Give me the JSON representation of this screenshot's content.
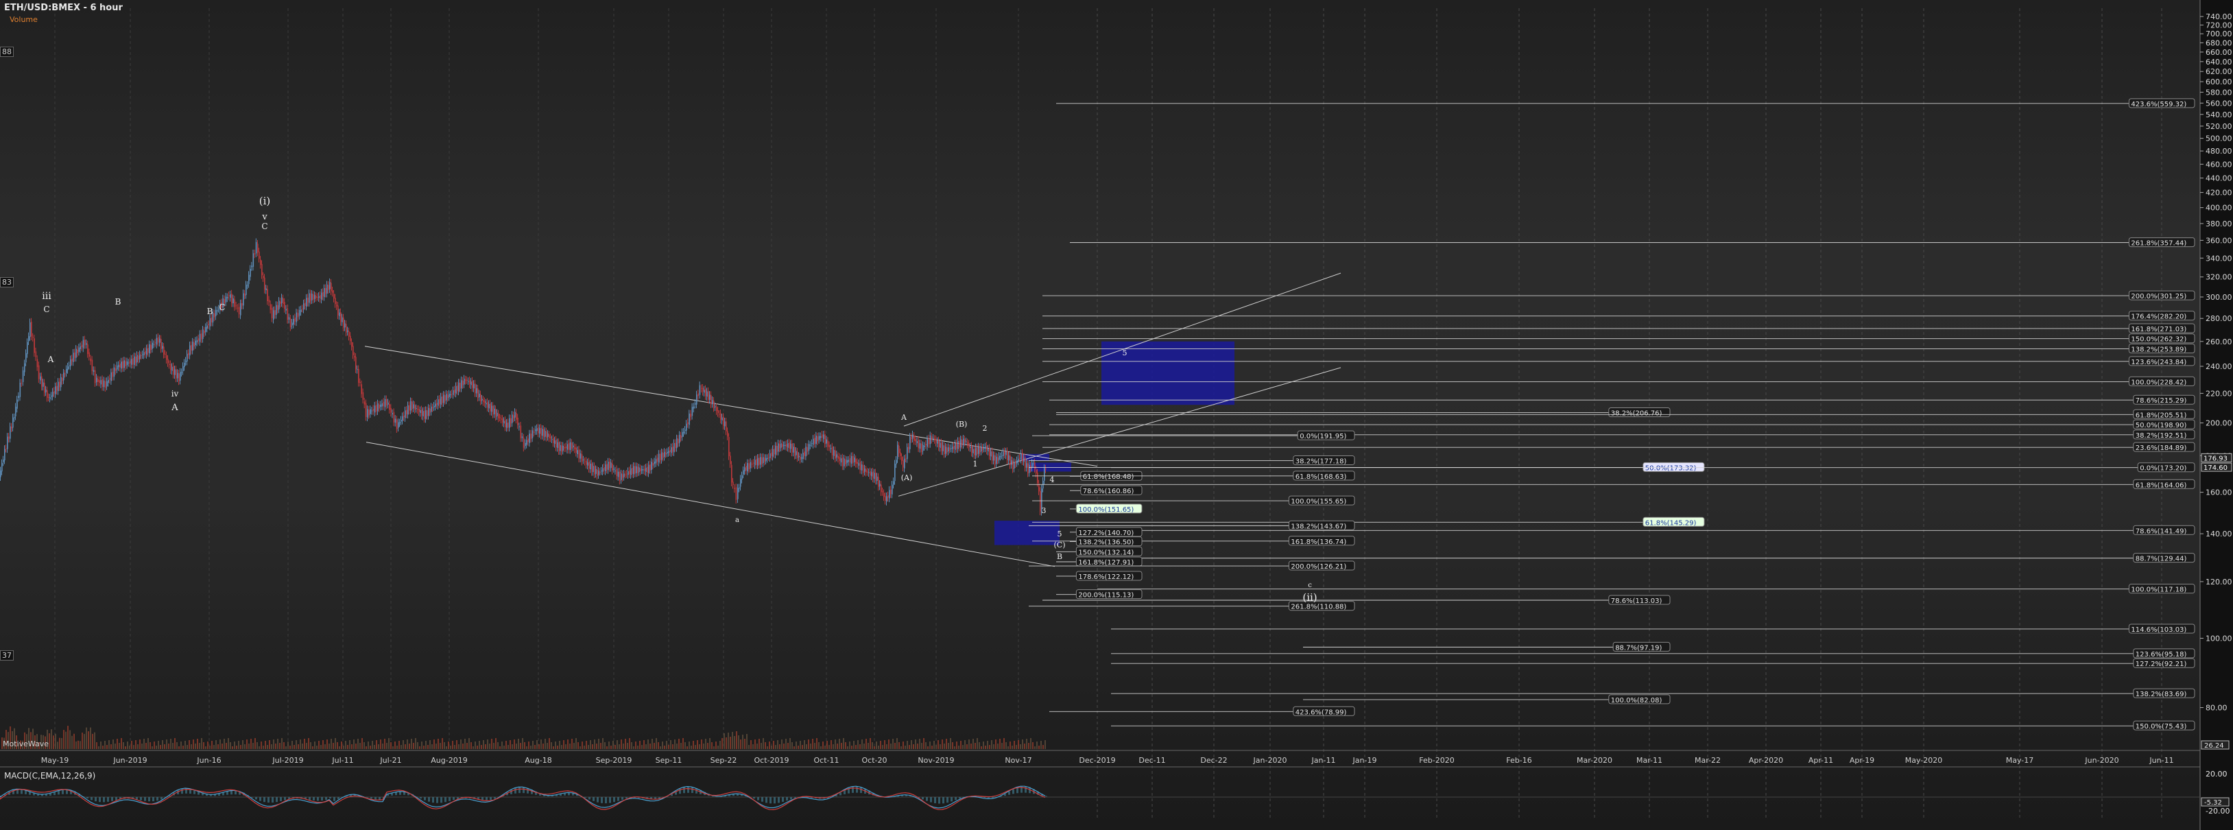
{
  "header": {
    "title": "ETH/USD:BMEX - 6 hour",
    "subtitle": "Volume"
  },
  "indicators": {
    "macd_label": "MACD(C,EMA,12,26,9)",
    "macd_ticks": [
      "20.00",
      "-20.00"
    ],
    "macd_value": "-5.32",
    "volume_label": "MotiveWave",
    "volume_value": "26.24"
  },
  "left_edge_labels": [
    "88",
    "83",
    "37"
  ],
  "colors": {
    "up": "#5f90bc",
    "down": "#c0393b",
    "box": "#1a1a9a",
    "grid": "#3a3a3a",
    "line": "#cfcfcf"
  },
  "chart_data": {
    "type": "candlestick",
    "title": "ETH/USD:BMEX - 6 hour",
    "price_axis": {
      "ticks": [
        740,
        720,
        700,
        680,
        660,
        640,
        620,
        600,
        580,
        560,
        540,
        520,
        500,
        480,
        460,
        440,
        420,
        400,
        380,
        360,
        340,
        320,
        300,
        280,
        260,
        240,
        220,
        200,
        180,
        160,
        140,
        120,
        100,
        80
      ],
      "tick_labels": [
        "740.00",
        "720.00",
        "700.00",
        "680.00",
        "660.00",
        "640.00",
        "620.00",
        "600.00",
        "580.00",
        "560.00",
        "540.00",
        "520.00",
        "500.00",
        "480.00",
        "460.00",
        "440.00",
        "420.00",
        "400.00",
        "380.00",
        "360.00",
        "340.00",
        "320.00",
        "300.00",
        "280.00",
        "260.00",
        "240.00",
        "220.00",
        "200.00",
        "180.00",
        "160.00",
        "140.00",
        "120.00",
        "100.00",
        "80.00"
      ],
      "scale": "log",
      "current_price_labels": [
        "176.93",
        "174.60"
      ]
    },
    "time_axis": {
      "labels": [
        "May-19",
        "Jun-2019",
        "Jun-16",
        "Jul-2019",
        "Jul-11",
        "Jul-21",
        "Aug-2019",
        "Aug-18",
        "Sep-2019",
        "Sep-11",
        "Sep-22",
        "Oct-2019",
        "Oct-11",
        "Oct-20",
        "Nov-2019",
        "Nov-17",
        "Dec-2019",
        "Dec-11",
        "Dec-22",
        "Jan-2020",
        "Jan-11",
        "Jan-19",
        "Feb-2020",
        "Feb-16",
        "Mar-2020",
        "Mar-11",
        "Mar-22",
        "Apr-2020",
        "Apr-11",
        "Apr-19",
        "May-2020",
        "May-17",
        "Jun-2020",
        "Jun-11"
      ]
    },
    "price_path": [
      [
        0,
        168
      ],
      [
        10,
        186
      ],
      [
        22,
        205
      ],
      [
        35,
        235
      ],
      [
        45,
        274
      ],
      [
        58,
        232
      ],
      [
        72,
        216
      ],
      [
        88,
        227
      ],
      [
        108,
        248
      ],
      [
        125,
        260
      ],
      [
        140,
        230
      ],
      [
        155,
        226
      ],
      [
        172,
        240
      ],
      [
        195,
        244
      ],
      [
        215,
        252
      ],
      [
        232,
        262
      ],
      [
        248,
        240
      ],
      [
        262,
        231
      ],
      [
        278,
        254
      ],
      [
        295,
        265
      ],
      [
        318,
        288
      ],
      [
        335,
        302
      ],
      [
        350,
        286
      ],
      [
        362,
        314
      ],
      [
        375,
        355
      ],
      [
        385,
        316
      ],
      [
        398,
        282
      ],
      [
        412,
        298
      ],
      [
        425,
        274
      ],
      [
        438,
        286
      ],
      [
        452,
        300
      ],
      [
        468,
        300
      ],
      [
        482,
        312
      ],
      [
        494,
        285
      ],
      [
        510,
        265
      ],
      [
        520,
        240
      ],
      [
        535,
        206
      ],
      [
        550,
        210
      ],
      [
        565,
        214
      ],
      [
        580,
        198
      ],
      [
        600,
        212
      ],
      [
        620,
        205
      ],
      [
        640,
        214
      ],
      [
        660,
        220
      ],
      [
        680,
        230
      ],
      [
        690,
        226
      ],
      [
        702,
        216
      ],
      [
        720,
        208
      ],
      [
        740,
        198
      ],
      [
        752,
        206
      ],
      [
        765,
        186
      ],
      [
        782,
        196
      ],
      [
        800,
        192
      ],
      [
        818,
        184
      ],
      [
        835,
        186
      ],
      [
        852,
        177
      ],
      [
        872,
        170
      ],
      [
        890,
        175
      ],
      [
        905,
        168
      ],
      [
        925,
        172
      ],
      [
        945,
        172
      ],
      [
        962,
        179
      ],
      [
        982,
        184
      ],
      [
        1000,
        196
      ],
      [
        1015,
        214
      ],
      [
        1022,
        224
      ],
      [
        1034,
        218
      ],
      [
        1050,
        205
      ],
      [
        1060,
        197
      ],
      [
        1068,
        166
      ],
      [
        1075,
        158
      ],
      [
        1085,
        172
      ],
      [
        1100,
        176
      ],
      [
        1118,
        178
      ],
      [
        1138,
        186
      ],
      [
        1152,
        186
      ],
      [
        1168,
        178
      ],
      [
        1185,
        188
      ],
      [
        1200,
        192
      ],
      [
        1215,
        182
      ],
      [
        1230,
        176
      ],
      [
        1245,
        178
      ],
      [
        1260,
        172
      ],
      [
        1278,
        168
      ],
      [
        1292,
        156
      ],
      [
        1302,
        162
      ],
      [
        1310,
        185
      ],
      [
        1318,
        174
      ],
      [
        1330,
        192
      ],
      [
        1345,
        184
      ],
      [
        1360,
        191
      ],
      [
        1378,
        183
      ],
      [
        1392,
        185
      ],
      [
        1408,
        189
      ],
      [
        1420,
        182
      ],
      [
        1438,
        185
      ],
      [
        1452,
        177
      ],
      [
        1466,
        182
      ],
      [
        1478,
        174
      ],
      [
        1490,
        180
      ],
      [
        1500,
        172
      ],
      [
        1508,
        176
      ],
      [
        1514,
        166
      ],
      [
        1518,
        152
      ],
      [
        1522,
        168
      ],
      [
        1526,
        174
      ]
    ],
    "fib_levels": [
      {
        "label": "423.6%(559.32)",
        "price": 559.32
      },
      {
        "label": "261.8%(357.44)",
        "price": 357.44
      },
      {
        "label": "200.0%(301.25)",
        "price": 301.25
      },
      {
        "label": "176.4%(282.20)",
        "price": 282.2
      },
      {
        "label": "161.8%(271.03)",
        "price": 271.03
      },
      {
        "label": "150.0%(262.32)",
        "price": 262.32
      },
      {
        "label": "138.2%(253.89)",
        "price": 253.89
      },
      {
        "label": "123.6%(243.84)",
        "price": 243.84
      },
      {
        "label": "100.0%(228.42)",
        "price": 228.42
      },
      {
        "label": "78.6%(215.29)",
        "price": 215.29
      },
      {
        "label": "38.2%(206.76)",
        "price": 206.76
      },
      {
        "label": "61.8%(205.51)",
        "price": 205.51
      },
      {
        "label": "50.0%(198.90)",
        "price": 198.9
      },
      {
        "label": "38.2%(192.51)",
        "price": 192.51
      },
      {
        "label": "0.0%(191.95)",
        "price": 191.95
      },
      {
        "label": "23.6%(184.89)",
        "price": 184.89
      },
      {
        "label": "38.2%(177.18)",
        "price": 177.18
      },
      {
        "label": "50.0%(173.32)",
        "price": 173.32
      },
      {
        "label": "0.0%(173.20)",
        "price": 173.2
      },
      {
        "label": "61.8%(168.48)",
        "price": 168.48
      },
      {
        "label": "61.8%(168.63)",
        "price": 168.63
      },
      {
        "label": "61.8%(164.06)",
        "price": 164.06
      },
      {
        "label": "78.6%(160.86)",
        "price": 160.86
      },
      {
        "label": "100.0%(155.65)",
        "price": 155.65
      },
      {
        "label": "100.0%(151.65)",
        "price": 151.65
      },
      {
        "label": "61.8%(145.29)",
        "price": 145.29
      },
      {
        "label": "138.2%(143.67)",
        "price": 143.67
      },
      {
        "label": "78.6%(141.49)",
        "price": 141.49
      },
      {
        "label": "127.2%(140.70)",
        "price": 140.7
      },
      {
        "label": "161.8%(136.74)",
        "price": 136.74
      },
      {
        "label": "138.2%(136.50)",
        "price": 136.5
      },
      {
        "label": "150.0%(132.14)",
        "price": 132.14
      },
      {
        "label": "88.7%(129.44)",
        "price": 129.44
      },
      {
        "label": "161.8%(127.91)",
        "price": 127.91
      },
      {
        "label": "200.0%(126.21)",
        "price": 126.21
      },
      {
        "label": "178.6%(122.12)",
        "price": 122.12
      },
      {
        "label": "100.0%(117.18)",
        "price": 117.18
      },
      {
        "label": "200.0%(115.13)",
        "price": 115.13
      },
      {
        "label": "78.6%(113.03)",
        "price": 113.03
      },
      {
        "label": "261.8%(110.88)",
        "price": 110.88
      },
      {
        "label": "114.6%(103.03)",
        "price": 103.03
      },
      {
        "label": "88.7%(97.19)",
        "price": 97.19
      },
      {
        "label": "123.6%(95.18)",
        "price": 95.18
      },
      {
        "label": "127.2%(92.21)",
        "price": 92.21
      },
      {
        "label": "138.2%(83.69)",
        "price": 83.69
      },
      {
        "label": "100.0%(82.08)",
        "price": 82.08
      },
      {
        "label": "423.6%(78.99)",
        "price": 78.99
      },
      {
        "label": "150.0%(75.43)",
        "price": 75.43
      }
    ],
    "wave_labels": [
      "iii",
      "C",
      "A",
      "B",
      "C",
      "iv",
      "A",
      "B",
      "(i)",
      "v",
      "C",
      "a",
      "(A)",
      "A",
      "(B)",
      "2",
      "1",
      "4",
      "3",
      "5",
      "(C)",
      "B",
      "c",
      "(ii)",
      "5"
    ],
    "target_boxes": [
      {
        "price_from": 260,
        "price_to": 212
      },
      {
        "price_from": 146,
        "price_to": 135
      },
      {
        "price_from": 181,
        "price_to": 177
      },
      {
        "price_from": 176,
        "price_to": 171
      }
    ]
  }
}
